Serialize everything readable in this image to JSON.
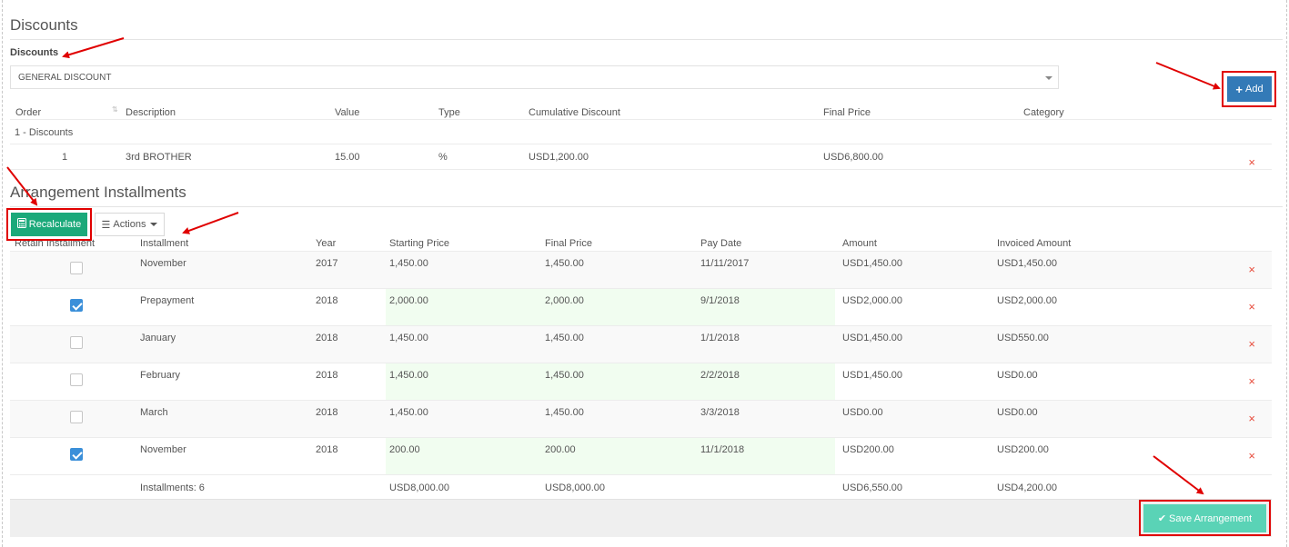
{
  "discounts": {
    "section_title": "Discounts",
    "field_label": "Discounts",
    "selected_discount": "GENERAL DISCOUNT",
    "add_label": "Add",
    "columns": [
      "Order",
      "Description",
      "Value",
      "Type",
      "Cumulative Discount",
      "Final Price",
      "Category"
    ],
    "group_label": "1 - Discounts",
    "rows": [
      {
        "order": "1",
        "description": "3rd BROTHER",
        "value": "15.00",
        "type": "%",
        "cumulative": "USD1,200.00",
        "final_price": "USD6,800.00",
        "category": ""
      }
    ],
    "delete_glyph": "×"
  },
  "installments": {
    "section_title": "Arrangement Installments",
    "recalculate_label": "Recalculate",
    "actions_label": "Actions",
    "columns": [
      "Retain Installment",
      "Installment",
      "Year",
      "Starting Price",
      "Final Price",
      "Pay Date",
      "Amount",
      "Invoiced Amount"
    ],
    "rows": [
      {
        "retain": false,
        "installment": "November",
        "year": "2017",
        "starting": "1,450.00",
        "final": "1,450.00",
        "pay_date": "11/11/2017",
        "amount": "USD1,450.00",
        "invoiced": "USD1,450.00"
      },
      {
        "retain": true,
        "installment": "Prepayment",
        "year": "2018",
        "starting": "2,000.00",
        "final": "2,000.00",
        "pay_date": "9/1/2018",
        "amount": "USD2,000.00",
        "invoiced": "USD2,000.00"
      },
      {
        "retain": false,
        "installment": "January",
        "year": "2018",
        "starting": "1,450.00",
        "final": "1,450.00",
        "pay_date": "1/1/2018",
        "amount": "USD1,450.00",
        "invoiced": "USD550.00"
      },
      {
        "retain": false,
        "installment": "February",
        "year": "2018",
        "starting": "1,450.00",
        "final": "1,450.00",
        "pay_date": "2/2/2018",
        "amount": "USD1,450.00",
        "invoiced": "USD0.00"
      },
      {
        "retain": false,
        "installment": "March",
        "year": "2018",
        "starting": "1,450.00",
        "final": "1,450.00",
        "pay_date": "3/3/2018",
        "amount": "USD0.00",
        "invoiced": "USD0.00"
      },
      {
        "retain": true,
        "installment": "November",
        "year": "2018",
        "starting": "200.00",
        "final": "200.00",
        "pay_date": "11/1/2018",
        "amount": "USD200.00",
        "invoiced": "USD200.00"
      }
    ],
    "totals": {
      "count_label": "Installments: 6",
      "starting": "USD8,000.00",
      "final": "USD8,000.00",
      "amount": "USD6,550.00",
      "invoiced": "USD4,200.00"
    },
    "save_label": "Save Arrangement"
  },
  "colors": {
    "primary": "#337ab7",
    "success": "#1ba97a",
    "save": "#5ad3b6",
    "highlight": "#e00000",
    "delete": "#e74c3c"
  }
}
